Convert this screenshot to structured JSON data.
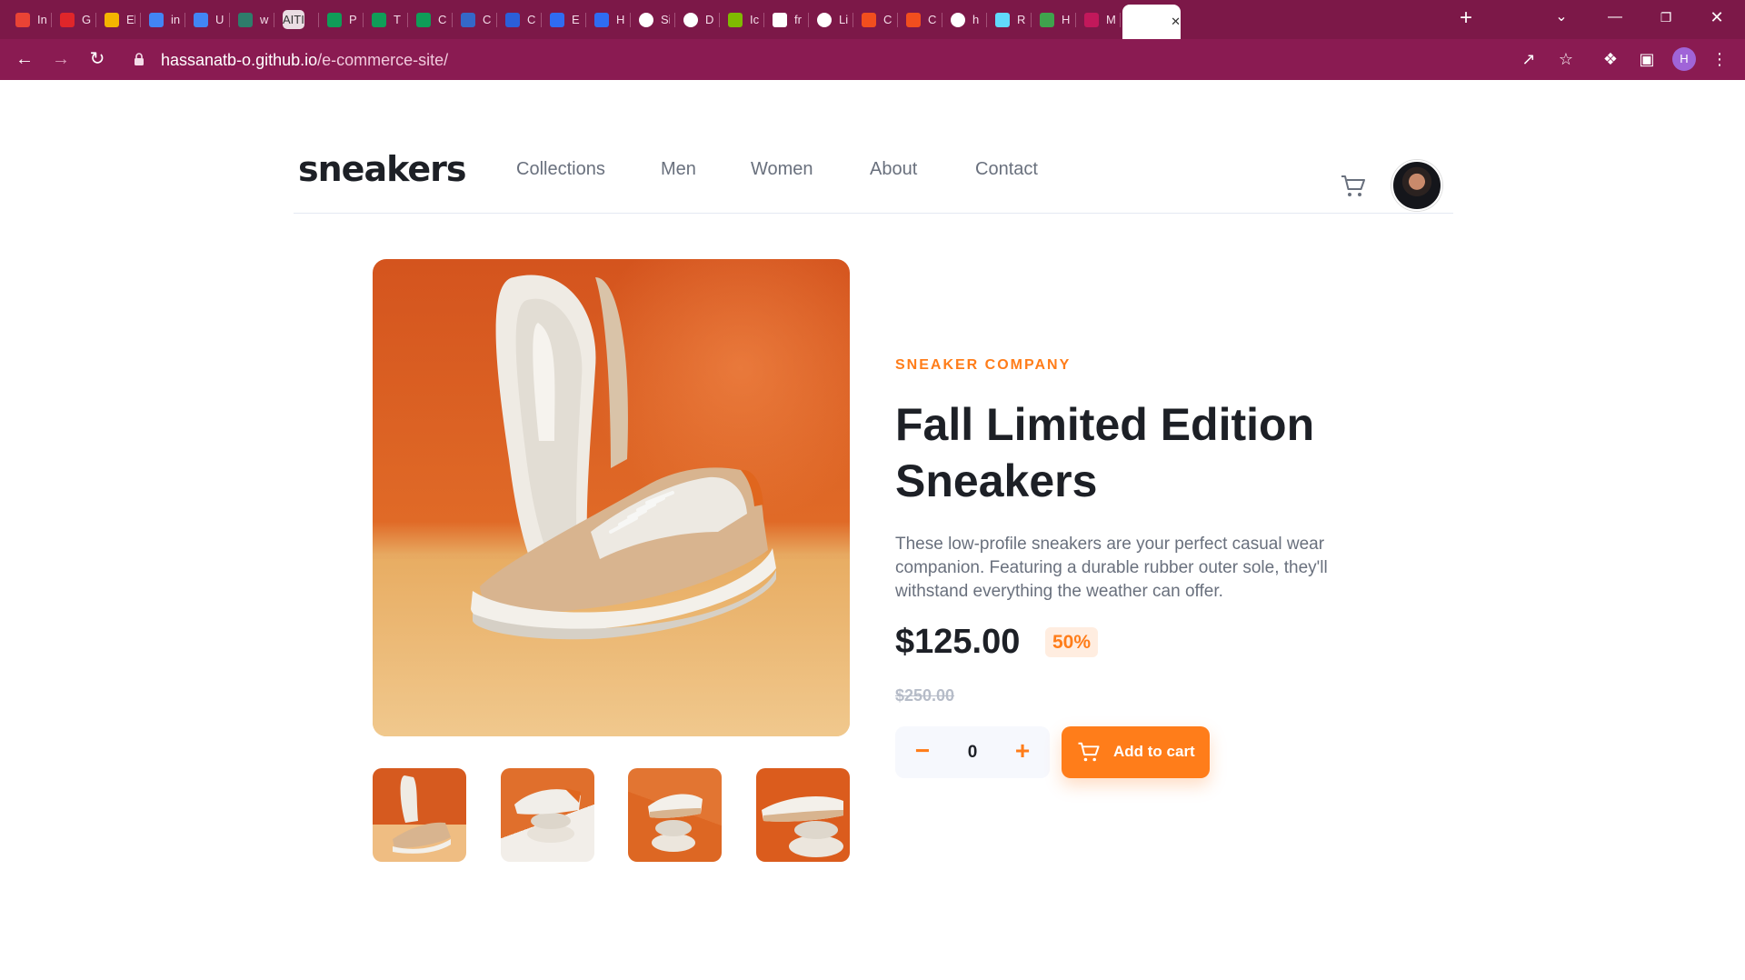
{
  "browser": {
    "tabs": [
      {
        "title": "In",
        "favicon": "gmail-icon",
        "color": "#ea4335"
      },
      {
        "title": "G",
        "favicon": "pdf-icon",
        "color": "#e0262a"
      },
      {
        "title": "El",
        "favicon": "slides-icon",
        "color": "#f4b400"
      },
      {
        "title": "in",
        "favicon": "google-icon",
        "color": "#4285f4"
      },
      {
        "title": "U",
        "favicon": "docs-icon",
        "color": "#4285f4"
      },
      {
        "title": "w",
        "favicon": "eye-icon",
        "color": "#2e7d6b"
      },
      {
        "title": "AITI",
        "favicon": "aiti-icon",
        "color": "#eadde3"
      },
      {
        "title": "P",
        "favicon": "sheets-icon",
        "color": "#0f9d58"
      },
      {
        "title": "T",
        "favicon": "sheets-icon",
        "color": "#0f9d58"
      },
      {
        "title": "C",
        "favicon": "sheets-icon",
        "color": "#0f9d58"
      },
      {
        "title": "C",
        "favicon": "css-grid-icon",
        "color": "#3468c8"
      },
      {
        "title": "C",
        "favicon": "a-icon",
        "color": "#2b5fd9"
      },
      {
        "title": "E",
        "favicon": "diamond-icon",
        "color": "#2f6cf2"
      },
      {
        "title": "H",
        "favicon": "diamond-icon",
        "color": "#2f6cf2"
      },
      {
        "title": "Si",
        "favicon": "globe-icon",
        "color": "#ffffff"
      },
      {
        "title": "D",
        "favicon": "globe-icon",
        "color": "#ffffff"
      },
      {
        "title": "Ic",
        "favicon": "microsoft-icon",
        "color": "#7fba00"
      },
      {
        "title": "fr",
        "favicon": "m-icon",
        "color": "#ffffff"
      },
      {
        "title": "Li",
        "favicon": "globe-icon",
        "color": "#ffffff"
      },
      {
        "title": "C",
        "favicon": "figma-icon",
        "color": "#f24e1e"
      },
      {
        "title": "C",
        "favicon": "figma-icon",
        "color": "#f24e1e"
      },
      {
        "title": "h",
        "favicon": "globe-icon",
        "color": "#ffffff"
      },
      {
        "title": "R",
        "favicon": "react-icon",
        "color": "#61dafb"
      },
      {
        "title": "H",
        "favicon": "infinity-icon",
        "color": "#3fa34d"
      },
      {
        "title": "M",
        "favicon": "heart-icon",
        "color": "#c2185b"
      },
      {
        "title": "",
        "favicon": "site-icon",
        "color": "#ffffff",
        "active": true
      }
    ],
    "url_host": "hassanatb-o.github.io",
    "url_path": "/e-commerce-site/",
    "profile_initial": "H"
  },
  "site": {
    "logo": "sneakers",
    "nav": [
      "Collections",
      "Men",
      "Women",
      "About",
      "Contact"
    ]
  },
  "product": {
    "company": "SNEAKER COMPANY",
    "title": "Fall Limited Edition Sneakers",
    "description": "These low-profile sneakers are your perfect casual wear companion. Featuring a durable rubber outer sole, they'll withstand everything the weather can offer.",
    "price": "$125.00",
    "discount": "50%",
    "old_price": "$250.00",
    "quantity": "0",
    "add_to_cart": "Add to cart"
  },
  "colors": {
    "accent": "#ff7d1a",
    "tab_bar": "#7c1848",
    "toolbar": "#8a1b52"
  }
}
